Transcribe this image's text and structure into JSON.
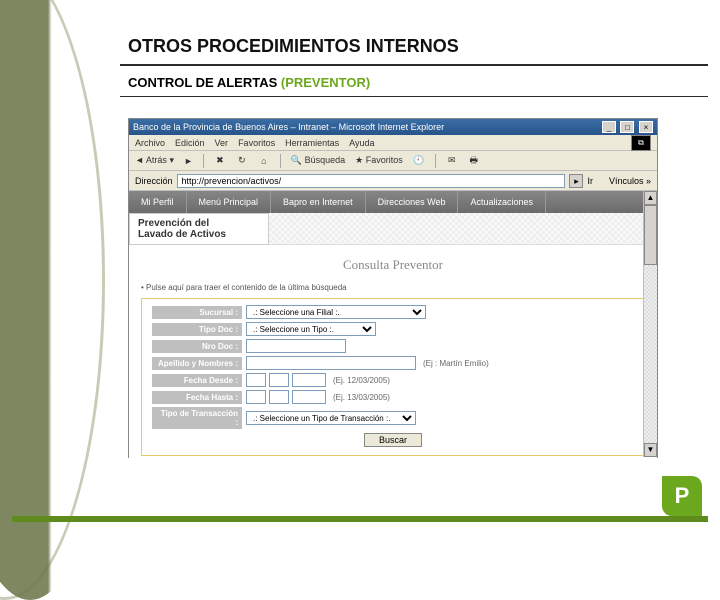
{
  "slide": {
    "title": "OTROS PROCEDIMIENTOS INTERNOS",
    "subtitle_plain": "CONTROL DE ALERTAS ",
    "subtitle_accent": "(PREVENTOR)"
  },
  "browser": {
    "window_title": "Banco de la Provincia de Buenos Aires – Intranet – Microsoft Internet Explorer",
    "menus": {
      "archivo": "Archivo",
      "edicion": "Edición",
      "ver": "Ver",
      "favoritos": "Favoritos",
      "herramientas": "Herramientas",
      "ayuda": "Ayuda"
    },
    "toolbar": {
      "back": "Atrás",
      "search": "Búsqueda",
      "favorites": "Favoritos"
    },
    "addrbar": {
      "label": "Dirección",
      "value": "http://prevencion/activos/",
      "go": "Ir",
      "links_label": "Vínculos"
    },
    "app_nav": {
      "mi_perfil": "Mi Perfil",
      "menu_principal": "Menú Principal",
      "bapro": "Bapro en Internet",
      "direcciones": "Direcciones Web",
      "actualizaciones": "Actualizaciones"
    },
    "section_tab_line1": "Prevención del",
    "section_tab_line2": "Lavado de Activos",
    "content": {
      "heading": "Consulta Preventor",
      "helper": "Pulse aquí para traer el contenido de la última búsqueda",
      "labels": {
        "sucursal": "Sucursal :",
        "tipo_doc": "Tipo Doc :",
        "nro_doc": "Nro Doc :",
        "apellido_nombres": "Apellido y Nombres :",
        "fecha_desde": "Fecha Desde :",
        "fecha_hasta": "Fecha Hasta :",
        "tipo_transaccion": "Tipo de Transacción :"
      },
      "placeholders": {
        "sucursal": ".: Seleccione una Filial :.",
        "tipo_doc": ".: Seleccione un Tipo :.",
        "tipo_transaccion": ".: Seleccione un Tipo de Transacción :."
      },
      "hints": {
        "apellido": "(Ej : Martín Emilio)",
        "fecha_desde": "(Ej. 12/03/2005)",
        "fecha_hasta": "(Ej. 13/03/2005)"
      },
      "buscar": "Buscar"
    }
  }
}
